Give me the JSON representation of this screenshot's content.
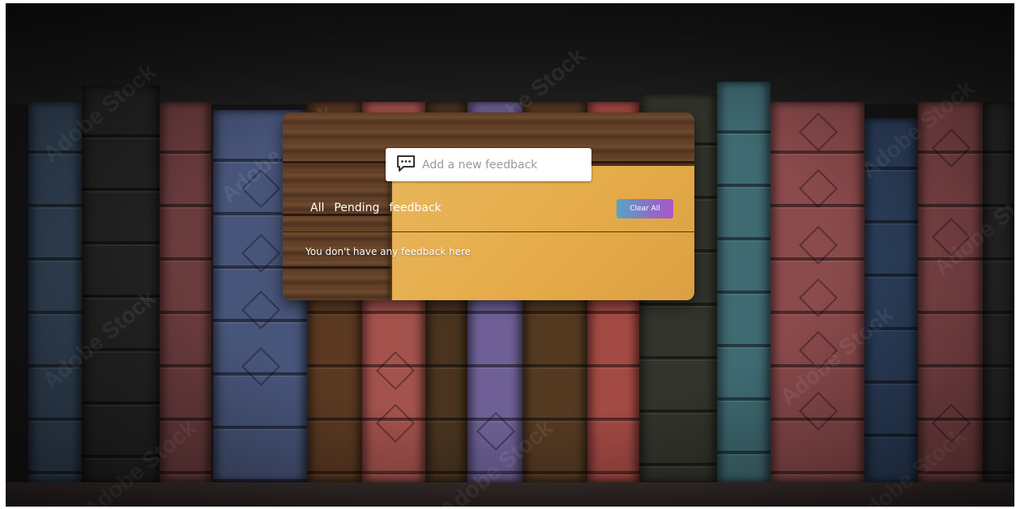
{
  "feedback_input": {
    "placeholder": "Add a new feedback",
    "icon": "comment-dots-icon"
  },
  "filters": {
    "all_label": "All",
    "pending_label": "Pending",
    "feedback_label": "feedback"
  },
  "clear_button_label": "Clear All",
  "empty_message": "You don't have any feedback here",
  "background": {
    "watermark_text": "Adobe Stock"
  },
  "colors": {
    "clear_button_gradient": [
      "#5aa4c4",
      "#a957c9"
    ],
    "paper": "#e6ac4a",
    "wood": "#5e3d26"
  }
}
